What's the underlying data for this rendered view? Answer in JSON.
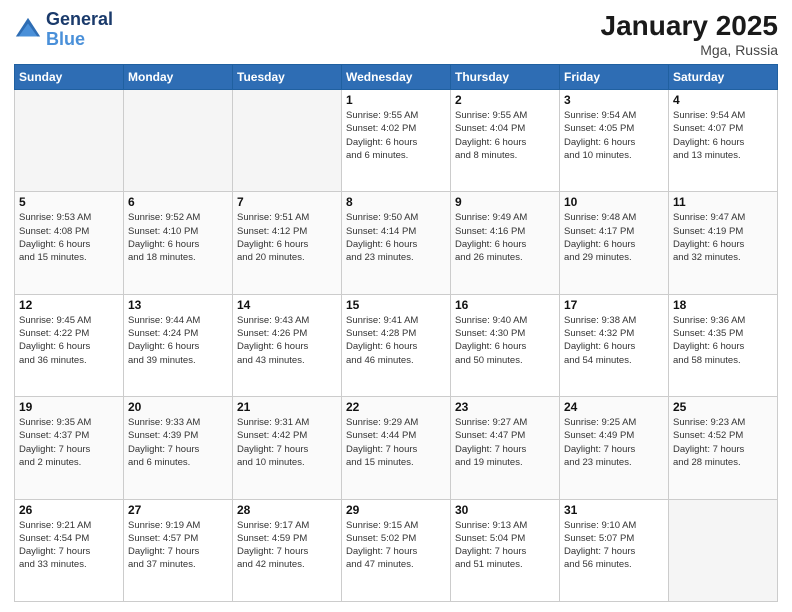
{
  "header": {
    "logo_line1": "General",
    "logo_line2": "Blue",
    "month": "January 2025",
    "location": "Mga, Russia"
  },
  "weekdays": [
    "Sunday",
    "Monday",
    "Tuesday",
    "Wednesday",
    "Thursday",
    "Friday",
    "Saturday"
  ],
  "weeks": [
    [
      {
        "day": "",
        "info": ""
      },
      {
        "day": "",
        "info": ""
      },
      {
        "day": "",
        "info": ""
      },
      {
        "day": "1",
        "info": "Sunrise: 9:55 AM\nSunset: 4:02 PM\nDaylight: 6 hours\nand 6 minutes."
      },
      {
        "day": "2",
        "info": "Sunrise: 9:55 AM\nSunset: 4:04 PM\nDaylight: 6 hours\nand 8 minutes."
      },
      {
        "day": "3",
        "info": "Sunrise: 9:54 AM\nSunset: 4:05 PM\nDaylight: 6 hours\nand 10 minutes."
      },
      {
        "day": "4",
        "info": "Sunrise: 9:54 AM\nSunset: 4:07 PM\nDaylight: 6 hours\nand 13 minutes."
      }
    ],
    [
      {
        "day": "5",
        "info": "Sunrise: 9:53 AM\nSunset: 4:08 PM\nDaylight: 6 hours\nand 15 minutes."
      },
      {
        "day": "6",
        "info": "Sunrise: 9:52 AM\nSunset: 4:10 PM\nDaylight: 6 hours\nand 18 minutes."
      },
      {
        "day": "7",
        "info": "Sunrise: 9:51 AM\nSunset: 4:12 PM\nDaylight: 6 hours\nand 20 minutes."
      },
      {
        "day": "8",
        "info": "Sunrise: 9:50 AM\nSunset: 4:14 PM\nDaylight: 6 hours\nand 23 minutes."
      },
      {
        "day": "9",
        "info": "Sunrise: 9:49 AM\nSunset: 4:16 PM\nDaylight: 6 hours\nand 26 minutes."
      },
      {
        "day": "10",
        "info": "Sunrise: 9:48 AM\nSunset: 4:17 PM\nDaylight: 6 hours\nand 29 minutes."
      },
      {
        "day": "11",
        "info": "Sunrise: 9:47 AM\nSunset: 4:19 PM\nDaylight: 6 hours\nand 32 minutes."
      }
    ],
    [
      {
        "day": "12",
        "info": "Sunrise: 9:45 AM\nSunset: 4:22 PM\nDaylight: 6 hours\nand 36 minutes."
      },
      {
        "day": "13",
        "info": "Sunrise: 9:44 AM\nSunset: 4:24 PM\nDaylight: 6 hours\nand 39 minutes."
      },
      {
        "day": "14",
        "info": "Sunrise: 9:43 AM\nSunset: 4:26 PM\nDaylight: 6 hours\nand 43 minutes."
      },
      {
        "day": "15",
        "info": "Sunrise: 9:41 AM\nSunset: 4:28 PM\nDaylight: 6 hours\nand 46 minutes."
      },
      {
        "day": "16",
        "info": "Sunrise: 9:40 AM\nSunset: 4:30 PM\nDaylight: 6 hours\nand 50 minutes."
      },
      {
        "day": "17",
        "info": "Sunrise: 9:38 AM\nSunset: 4:32 PM\nDaylight: 6 hours\nand 54 minutes."
      },
      {
        "day": "18",
        "info": "Sunrise: 9:36 AM\nSunset: 4:35 PM\nDaylight: 6 hours\nand 58 minutes."
      }
    ],
    [
      {
        "day": "19",
        "info": "Sunrise: 9:35 AM\nSunset: 4:37 PM\nDaylight: 7 hours\nand 2 minutes."
      },
      {
        "day": "20",
        "info": "Sunrise: 9:33 AM\nSunset: 4:39 PM\nDaylight: 7 hours\nand 6 minutes."
      },
      {
        "day": "21",
        "info": "Sunrise: 9:31 AM\nSunset: 4:42 PM\nDaylight: 7 hours\nand 10 minutes."
      },
      {
        "day": "22",
        "info": "Sunrise: 9:29 AM\nSunset: 4:44 PM\nDaylight: 7 hours\nand 15 minutes."
      },
      {
        "day": "23",
        "info": "Sunrise: 9:27 AM\nSunset: 4:47 PM\nDaylight: 7 hours\nand 19 minutes."
      },
      {
        "day": "24",
        "info": "Sunrise: 9:25 AM\nSunset: 4:49 PM\nDaylight: 7 hours\nand 23 minutes."
      },
      {
        "day": "25",
        "info": "Sunrise: 9:23 AM\nSunset: 4:52 PM\nDaylight: 7 hours\nand 28 minutes."
      }
    ],
    [
      {
        "day": "26",
        "info": "Sunrise: 9:21 AM\nSunset: 4:54 PM\nDaylight: 7 hours\nand 33 minutes."
      },
      {
        "day": "27",
        "info": "Sunrise: 9:19 AM\nSunset: 4:57 PM\nDaylight: 7 hours\nand 37 minutes."
      },
      {
        "day": "28",
        "info": "Sunrise: 9:17 AM\nSunset: 4:59 PM\nDaylight: 7 hours\nand 42 minutes."
      },
      {
        "day": "29",
        "info": "Sunrise: 9:15 AM\nSunset: 5:02 PM\nDaylight: 7 hours\nand 47 minutes."
      },
      {
        "day": "30",
        "info": "Sunrise: 9:13 AM\nSunset: 5:04 PM\nDaylight: 7 hours\nand 51 minutes."
      },
      {
        "day": "31",
        "info": "Sunrise: 9:10 AM\nSunset: 5:07 PM\nDaylight: 7 hours\nand 56 minutes."
      },
      {
        "day": "",
        "info": ""
      }
    ]
  ]
}
